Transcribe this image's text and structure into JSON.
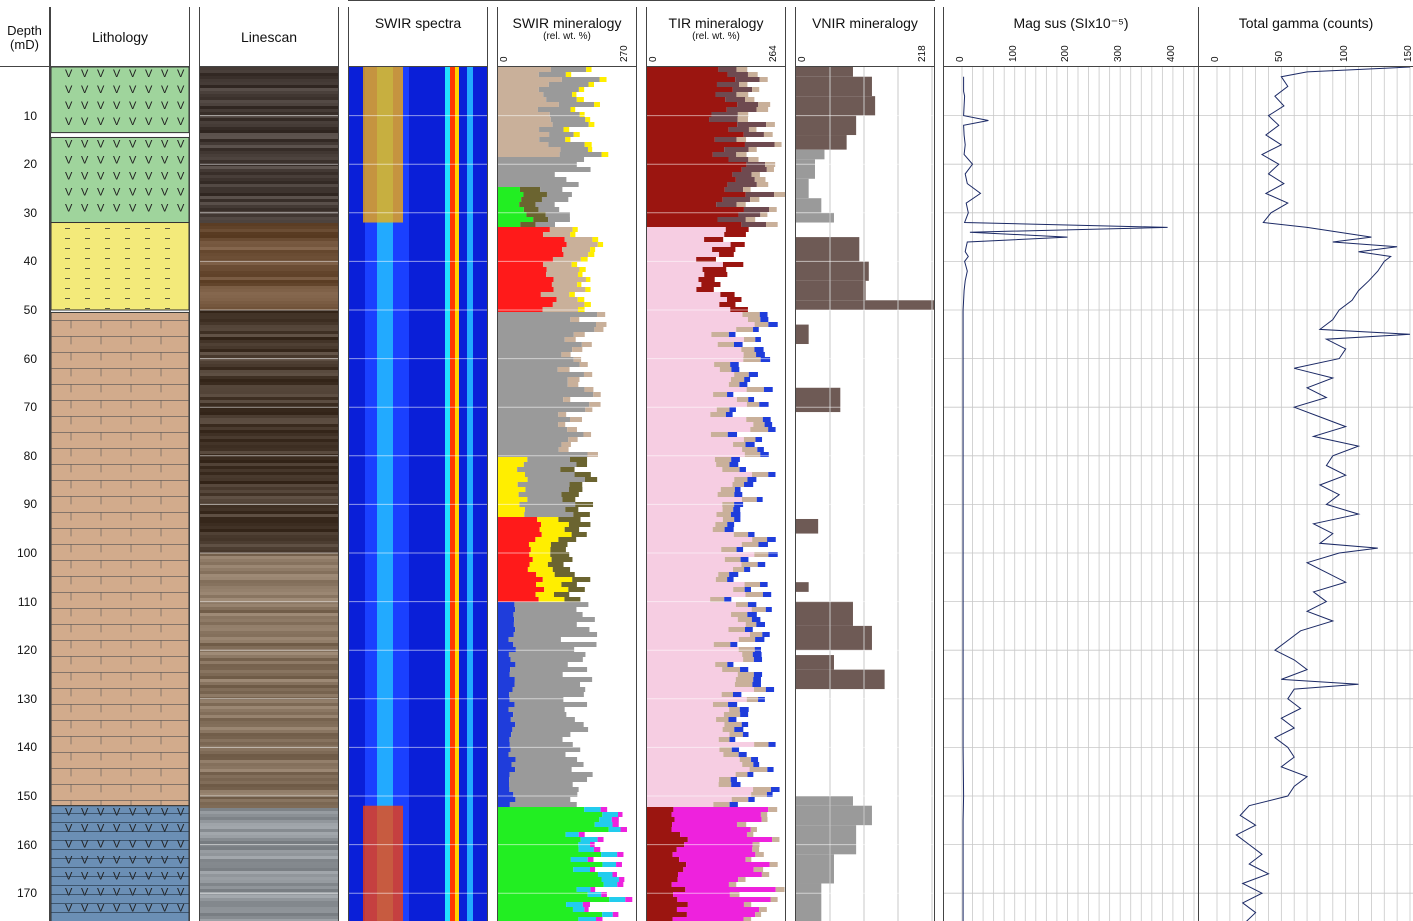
{
  "header": {
    "depth_title": "Depth",
    "depth_unit": "(mD)",
    "lithology": "Lithology",
    "linescan": "Linescan",
    "swir_spectra": "SWIR spectra",
    "swir_min": "SWIR mineralogy",
    "swir_min_sub": "(rel. wt. %)",
    "swir_min_max": "270",
    "tir_min": "TIR mineralogy",
    "tir_min_sub": "(rel. wt. %)",
    "tir_min_max": "264",
    "vnir_min": "VNIR mineralogy",
    "vnir_min_max": "218",
    "magsus": "Mag sus (SIx10⁻⁵)",
    "gamma": "Total gamma (counts)",
    "zero": "0"
  },
  "colors": {
    "grid": "#c8c8c8",
    "volcanic": "#9fd49c",
    "sandstone": "#f3ea7a",
    "mudstone": "#d2ab8c",
    "basalt": "#6b8fb5",
    "curve": "#1c2a66",
    "vnir_brown": "#6e5a55",
    "vnir_grey": "#9a9a9a",
    "tir_pink": "#f6cde2",
    "tir_red": "#9b1510",
    "magenta": "#ee22dd"
  },
  "chart_data": {
    "type": "well-log",
    "depth_axis": {
      "label": "Depth (mD)",
      "range": [
        0,
        176
      ],
      "ticks": [
        10,
        20,
        30,
        40,
        50,
        60,
        70,
        80,
        90,
        100,
        110,
        120,
        130,
        140,
        150,
        160,
        170
      ]
    },
    "lithology": [
      {
        "unit": "volcanic (V)",
        "top": 0,
        "base": 13.5
      },
      {
        "unit": "volcanic (V)",
        "top": 14.5,
        "base": 32
      },
      {
        "unit": "sandstone",
        "top": 32,
        "base": 50
      },
      {
        "unit": "mudstone/limestone",
        "top": 50.5,
        "base": 152
      },
      {
        "unit": "basalt",
        "top": 152,
        "base": 176
      }
    ],
    "mag_sus": {
      "xlabel": "Mag sus (SIx10⁻⁵)",
      "xlim": [
        0,
        440
      ],
      "ticks": [
        0,
        100,
        200,
        300,
        400
      ],
      "points": [
        [
          2,
          3
        ],
        [
          5,
          3
        ],
        [
          6,
          5
        ],
        [
          8,
          4
        ],
        [
          10,
          3
        ],
        [
          11,
          50
        ],
        [
          12,
          3
        ],
        [
          14,
          4
        ],
        [
          16,
          6
        ],
        [
          18,
          4
        ],
        [
          20,
          20
        ],
        [
          22,
          6
        ],
        [
          24,
          10
        ],
        [
          26,
          35
        ],
        [
          28,
          8
        ],
        [
          30,
          12
        ],
        [
          32,
          5
        ],
        [
          33,
          390
        ],
        [
          34,
          15
        ],
        [
          35,
          200
        ],
        [
          36,
          10
        ],
        [
          37,
          8
        ],
        [
          38,
          6
        ],
        [
          39,
          12
        ],
        [
          40,
          5
        ],
        [
          42,
          10
        ],
        [
          44,
          6
        ],
        [
          46,
          4
        ],
        [
          48,
          3
        ],
        [
          50,
          2
        ],
        [
          60,
          2
        ],
        [
          80,
          2
        ],
        [
          100,
          2
        ],
        [
          120,
          2
        ],
        [
          140,
          2
        ],
        [
          150,
          3
        ],
        [
          155,
          2
        ],
        [
          170,
          2
        ],
        [
          176,
          2
        ]
      ]
    },
    "gamma": {
      "xlabel": "Total gamma (counts)",
      "xlim": [
        0,
        150
      ],
      "ticks": [
        0,
        50,
        100,
        150
      ],
      "points": [
        [
          0,
          150
        ],
        [
          1,
          70
        ],
        [
          2,
          50
        ],
        [
          4,
          55
        ],
        [
          6,
          45
        ],
        [
          8,
          52
        ],
        [
          10,
          40
        ],
        [
          12,
          48
        ],
        [
          14,
          38
        ],
        [
          16,
          50
        ],
        [
          18,
          35
        ],
        [
          20,
          48
        ],
        [
          22,
          40
        ],
        [
          24,
          52
        ],
        [
          26,
          38
        ],
        [
          28,
          55
        ],
        [
          30,
          42
        ],
        [
          32,
          36
        ],
        [
          33,
          70
        ],
        [
          34,
          95
        ],
        [
          35,
          120
        ],
        [
          36,
          90
        ],
        [
          37,
          140
        ],
        [
          38,
          110
        ],
        [
          39,
          135
        ],
        [
          40,
          130
        ],
        [
          42,
          125
        ],
        [
          44,
          118
        ],
        [
          46,
          110
        ],
        [
          48,
          105
        ],
        [
          50,
          95
        ],
        [
          52,
          90
        ],
        [
          54,
          80
        ],
        [
          55,
          150
        ],
        [
          56,
          85
        ],
        [
          58,
          100
        ],
        [
          60,
          95
        ],
        [
          62,
          60
        ],
        [
          64,
          90
        ],
        [
          66,
          70
        ],
        [
          68,
          85
        ],
        [
          70,
          60
        ],
        [
          72,
          80
        ],
        [
          74,
          100
        ],
        [
          76,
          75
        ],
        [
          78,
          110
        ],
        [
          80,
          90
        ],
        [
          82,
          85
        ],
        [
          84,
          100
        ],
        [
          86,
          80
        ],
        [
          88,
          95
        ],
        [
          90,
          85
        ],
        [
          92,
          110
        ],
        [
          94,
          75
        ],
        [
          96,
          90
        ],
        [
          98,
          80
        ],
        [
          99,
          125
        ],
        [
          100,
          95
        ],
        [
          102,
          70
        ],
        [
          104,
          85
        ],
        [
          106,
          100
        ],
        [
          108,
          75
        ],
        [
          110,
          85
        ],
        [
          112,
          70
        ],
        [
          114,
          90
        ],
        [
          116,
          65
        ],
        [
          118,
          55
        ],
        [
          120,
          45
        ],
        [
          122,
          60
        ],
        [
          124,
          70
        ],
        [
          126,
          50
        ],
        [
          127,
          110
        ],
        [
          128,
          60
        ],
        [
          130,
          55
        ],
        [
          132,
          65
        ],
        [
          134,
          50
        ],
        [
          136,
          60
        ],
        [
          138,
          45
        ],
        [
          140,
          55
        ],
        [
          142,
          60
        ],
        [
          144,
          50
        ],
        [
          146,
          70
        ],
        [
          148,
          60
        ],
        [
          150,
          55
        ],
        [
          152,
          25
        ],
        [
          154,
          18
        ],
        [
          156,
          30
        ],
        [
          158,
          15
        ],
        [
          160,
          25
        ],
        [
          162,
          35
        ],
        [
          164,
          25
        ],
        [
          166,
          40
        ],
        [
          168,
          20
        ],
        [
          170,
          35
        ],
        [
          172,
          20
        ],
        [
          174,
          30
        ],
        [
          176,
          22
        ]
      ]
    },
    "vnir": {
      "xlim": [
        0,
        218
      ],
      "intervals": [
        {
          "top": 0,
          "base": 2,
          "value": 90,
          "mineral": "brown"
        },
        {
          "top": 2,
          "base": 6,
          "value": 120,
          "mineral": "brown"
        },
        {
          "top": 6,
          "base": 10,
          "value": 125,
          "mineral": "brown"
        },
        {
          "top": 10,
          "base": 14,
          "value": 95,
          "mineral": "brown"
        },
        {
          "top": 14,
          "base": 17,
          "value": 80,
          "mineral": "brown"
        },
        {
          "top": 17,
          "base": 19,
          "value": 45,
          "mineral": "grey"
        },
        {
          "top": 19,
          "base": 23,
          "value": 30,
          "mineral": "grey"
        },
        {
          "top": 23,
          "base": 27,
          "value": 20,
          "mineral": "grey"
        },
        {
          "top": 27,
          "base": 30,
          "value": 40,
          "mineral": "grey"
        },
        {
          "top": 30,
          "base": 32,
          "value": 60,
          "mineral": "grey"
        },
        {
          "top": 35,
          "base": 40,
          "value": 100,
          "mineral": "brown"
        },
        {
          "top": 40,
          "base": 44,
          "value": 115,
          "mineral": "brown"
        },
        {
          "top": 44,
          "base": 48,
          "value": 110,
          "mineral": "brown"
        },
        {
          "top": 48,
          "base": 50,
          "value": 218,
          "mineral": "brown"
        },
        {
          "top": 53,
          "base": 57,
          "value": 20,
          "mineral": "brown"
        },
        {
          "top": 66,
          "base": 71,
          "value": 70,
          "mineral": "brown"
        },
        {
          "top": 93,
          "base": 96,
          "value": 35,
          "mineral": "brown"
        },
        {
          "top": 106,
          "base": 108,
          "value": 20,
          "mineral": "brown"
        },
        {
          "top": 110,
          "base": 115,
          "value": 90,
          "mineral": "brown"
        },
        {
          "top": 115,
          "base": 120,
          "value": 120,
          "mineral": "brown"
        },
        {
          "top": 121,
          "base": 124,
          "value": 60,
          "mineral": "brown"
        },
        {
          "top": 124,
          "base": 128,
          "value": 140,
          "mineral": "brown"
        },
        {
          "top": 150,
          "base": 152,
          "value": 90,
          "mineral": "grey"
        },
        {
          "top": 152,
          "base": 156,
          "value": 120,
          "mineral": "grey"
        },
        {
          "top": 156,
          "base": 162,
          "value": 95,
          "mineral": "grey"
        },
        {
          "top": 162,
          "base": 168,
          "value": 60,
          "mineral": "grey"
        },
        {
          "top": 168,
          "base": 176,
          "value": 40,
          "mineral": "grey"
        }
      ]
    }
  }
}
